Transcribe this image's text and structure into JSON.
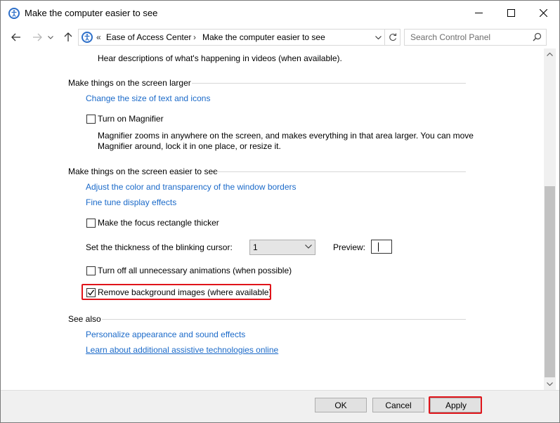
{
  "window": {
    "title": "Make the computer easier to see"
  },
  "address_bar": {
    "overflow": "«",
    "crumbs": [
      "Ease of Access Center",
      "Make the computer easier to see"
    ],
    "crumb_sep": "›"
  },
  "search": {
    "placeholder": "Search Control Panel"
  },
  "content": {
    "audio_description_text": "Hear descriptions of what's happening in videos (when available).",
    "larger": {
      "heading": "Make things on the screen larger",
      "link_text_size": "Change the size of text and icons",
      "magnifier_label": "Turn on Magnifier",
      "magnifier_checked": false,
      "magnifier_desc_line1": "Magnifier zooms in anywhere on the screen, and makes everything in that area larger. You can move",
      "magnifier_desc_line2": "Magnifier around, lock it in one place, or resize it."
    },
    "easier": {
      "heading": "Make things on the screen easier to see",
      "link_borders": "Adjust the color and transparency of the window borders",
      "link_display": "Fine tune display effects",
      "focus_label": "Make the focus rectangle thicker",
      "focus_checked": false,
      "cursor_label": "Set the thickness of the blinking cursor:",
      "cursor_value": "1",
      "preview_label": "Preview:",
      "animations_label": "Turn off all unnecessary animations (when possible)",
      "animations_checked": false,
      "background_label": "Remove background images (where available)",
      "background_checked": true
    },
    "see_also": {
      "heading": "See also",
      "link_personalize": "Personalize appearance and sound effects",
      "link_assistive": "Learn about additional assistive technologies online"
    }
  },
  "footer": {
    "ok_label": "OK",
    "cancel_label": "Cancel",
    "apply_label": "Apply"
  },
  "colors": {
    "link": "#1b6ac9",
    "highlight": "#e0141a"
  }
}
